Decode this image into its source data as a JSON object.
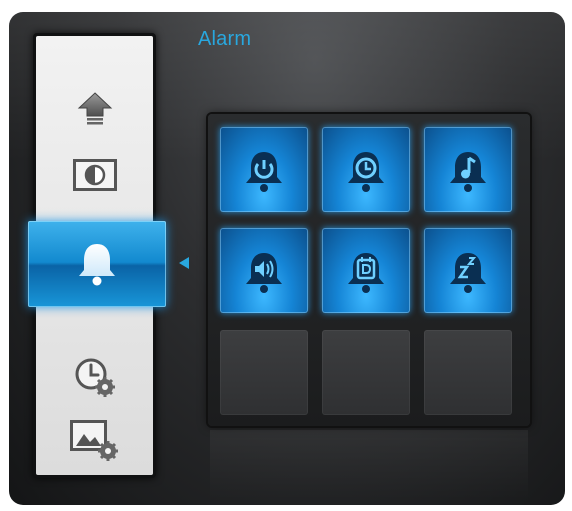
{
  "screen": {
    "title": "Alarm",
    "accent_color": "#29a7de",
    "sidebar": {
      "items": [
        {
          "name": "home",
          "icon": "home-icon",
          "active": false
        },
        {
          "name": "display",
          "icon": "display-contrast-icon",
          "active": false
        },
        {
          "name": "alarm",
          "icon": "alarm-bell-icon",
          "active": true
        },
        {
          "name": "time-settings",
          "icon": "clock-settings-icon",
          "active": false
        },
        {
          "name": "photo-settings",
          "icon": "photo-settings-icon",
          "active": false
        }
      ]
    },
    "grid": {
      "tiles": [
        {
          "icon": "alarm-power-icon",
          "enabled": true
        },
        {
          "icon": "alarm-clock-icon",
          "enabled": true
        },
        {
          "icon": "alarm-music-icon",
          "enabled": true
        },
        {
          "icon": "alarm-volume-icon",
          "enabled": true
        },
        {
          "icon": "alarm-calendar-icon",
          "enabled": true
        },
        {
          "icon": "alarm-snooze-icon",
          "enabled": true
        },
        {
          "icon": "",
          "enabled": false
        },
        {
          "icon": "",
          "enabled": false
        },
        {
          "icon": "",
          "enabled": false
        }
      ]
    }
  }
}
